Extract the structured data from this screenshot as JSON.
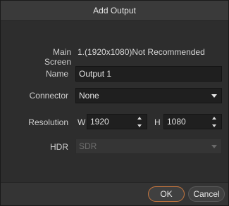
{
  "dialog": {
    "title": "Add Output"
  },
  "form": {
    "main_screen": {
      "label": "Main Screen",
      "value": "1.(1920x1080)Not Recommended"
    },
    "name": {
      "label": "Name",
      "value": "Output 1"
    },
    "connector": {
      "label": "Connector",
      "value": "None"
    },
    "resolution": {
      "label": "Resolution",
      "w_label": "W",
      "w_value": "1920",
      "h_label": "H",
      "h_value": "1080"
    },
    "hdr": {
      "label": "HDR",
      "value": "SDR"
    }
  },
  "footer": {
    "ok_label": "OK",
    "cancel_label": "Cancel"
  }
}
